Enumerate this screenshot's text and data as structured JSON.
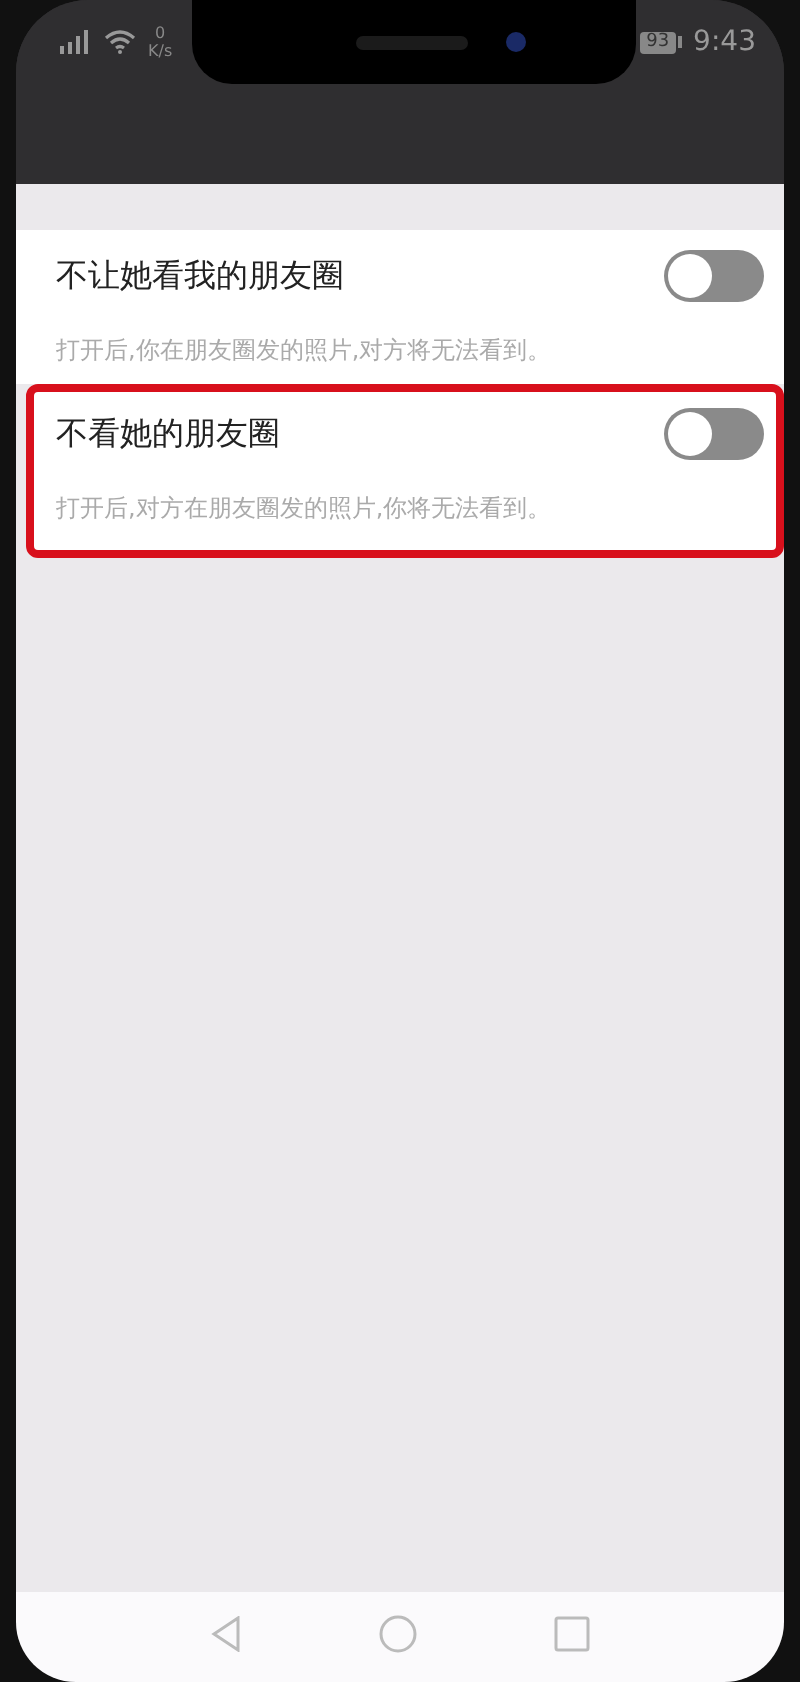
{
  "status_bar": {
    "speed_value": "0",
    "speed_unit": "K/s",
    "battery": "93",
    "time": "9:43"
  },
  "settings": [
    {
      "title": "不让她看我的朋友圈",
      "description": "打开后,你在朋友圈发的照片,对方将无法看到。",
      "on": false,
      "highlighted": false
    },
    {
      "title": "不看她的朋友圈",
      "description": "打开后,对方在朋友圈发的照片,你将无法看到。",
      "on": false,
      "highlighted": true
    }
  ]
}
